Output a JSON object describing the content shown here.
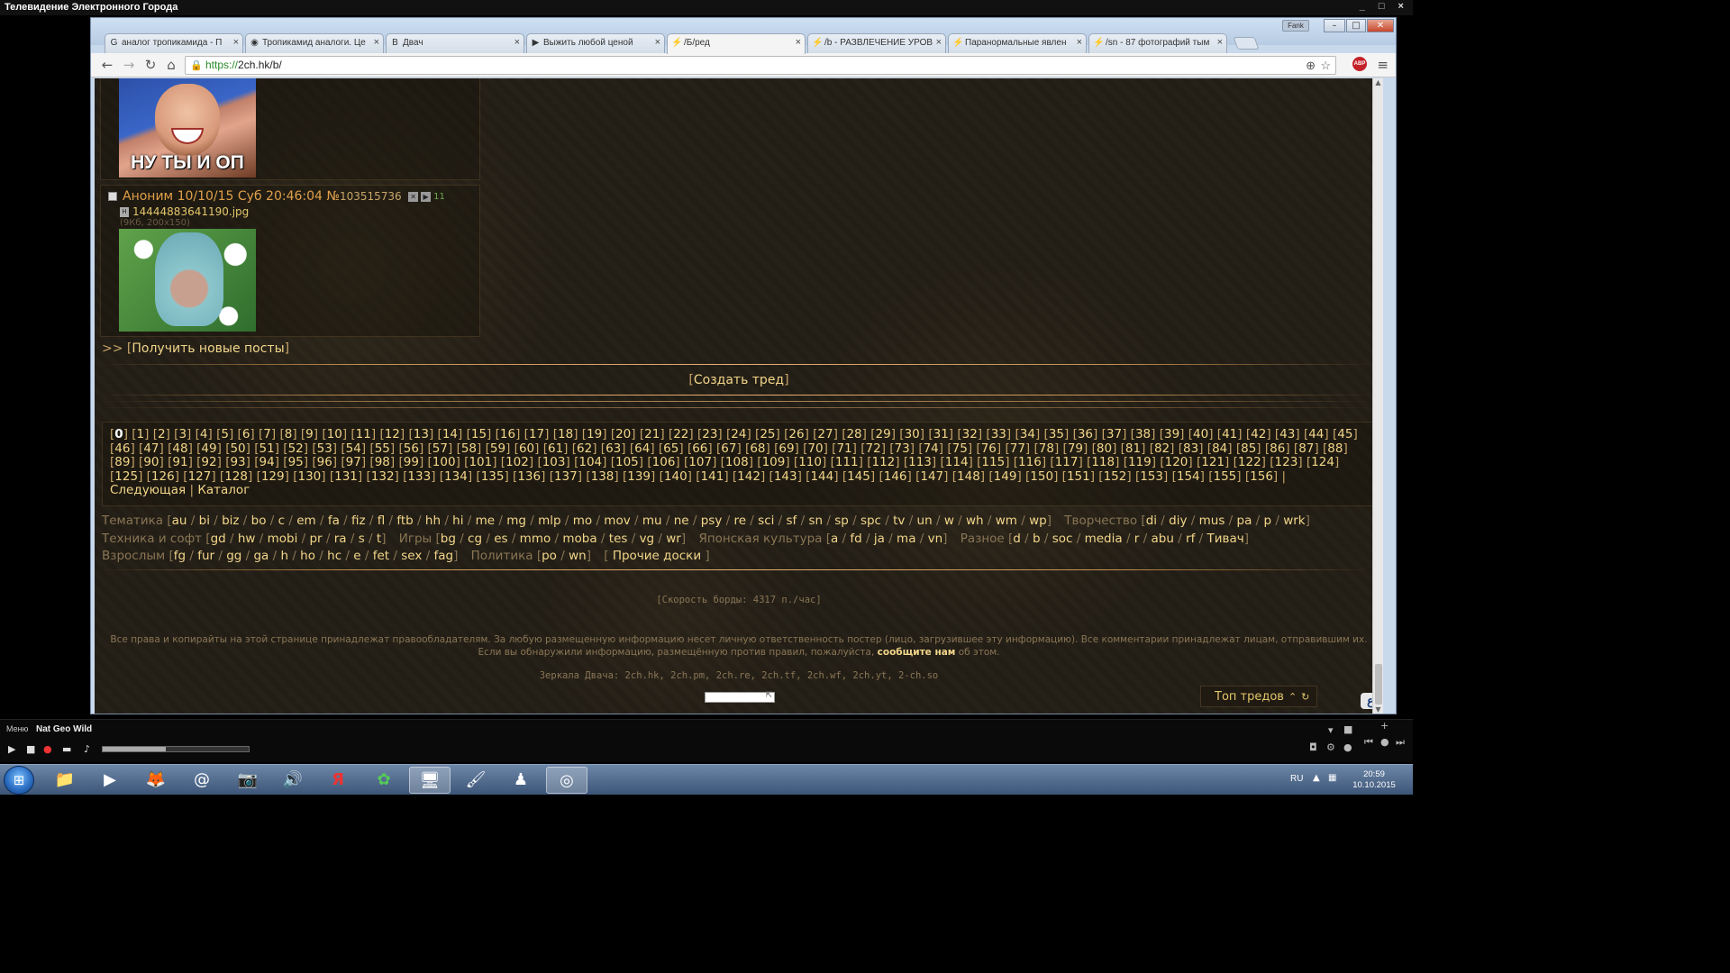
{
  "app": {
    "title": "Телевидение Электронного Города",
    "window_buttons": "_ □ ×"
  },
  "browser": {
    "profile": "Fank",
    "tabs": [
      {
        "label": "аналог тропикамида - П",
        "favicon": "G",
        "active": false
      },
      {
        "label": "Тропикамид аналоги. Це",
        "favicon": "◉",
        "active": false
      },
      {
        "label": "Двач",
        "favicon": "В",
        "active": false
      },
      {
        "label": "Выжить любой ценой",
        "favicon": "▶",
        "active": false
      },
      {
        "label": "/Б/ред",
        "favicon": "⚡",
        "active": true
      },
      {
        "label": "/b - РАЗВЛЕЧЕНИЕ УРОВ",
        "favicon": "⚡",
        "active": false
      },
      {
        "label": "Паранормальные явлен",
        "favicon": "⚡",
        "active": false
      },
      {
        "label": "/sn - 87 фотографий тым",
        "favicon": "⚡",
        "active": false
      }
    ],
    "tab_close": "×",
    "url_scheme": "https://",
    "url_rest": "2ch.hk/b/",
    "abp": "ABP"
  },
  "page": {
    "post1": {
      "caption": "НУ ТЫ И ОП"
    },
    "post2": {
      "author": "Аноним",
      "datetime": "10/10/15 Суб 20:46:04",
      "num_prefix": "№",
      "num": "103515736",
      "replies": "11",
      "filename": "14444883641190.jpg",
      "filemeta": "(9Кб, 200x150)"
    },
    "get_new": {
      "prefix": ">> [",
      "label": "Получить новые посты",
      "suffix": "]"
    },
    "create_thread": "Создать тред",
    "pager": {
      "pages": [
        "0",
        "1",
        "2",
        "3",
        "4",
        "5",
        "6",
        "7",
        "8",
        "9",
        "10",
        "11",
        "12",
        "13",
        "14",
        "15",
        "16",
        "17",
        "18",
        "19",
        "20",
        "21",
        "22",
        "23",
        "24",
        "25",
        "26",
        "27",
        "28",
        "29",
        "30",
        "31",
        "32",
        "33",
        "34",
        "35",
        "36",
        "37",
        "38",
        "39",
        "40",
        "41",
        "42",
        "43",
        "44",
        "45",
        "46",
        "47",
        "48",
        "49",
        "50",
        "51",
        "52",
        "53",
        "54",
        "55",
        "56",
        "57",
        "58",
        "59",
        "60",
        "61",
        "62",
        "63",
        "64",
        "65",
        "66",
        "67",
        "68",
        "69",
        "70",
        "71",
        "72",
        "73",
        "74",
        "75",
        "76",
        "77",
        "78",
        "79",
        "80",
        "81",
        "82",
        "83",
        "84",
        "85",
        "86",
        "87",
        "88",
        "89",
        "90",
        "91",
        "92",
        "93",
        "94",
        "95",
        "96",
        "97",
        "98",
        "99",
        "100",
        "101",
        "102",
        "103",
        "104",
        "105",
        "106",
        "107",
        "108",
        "109",
        "110",
        "111",
        "112",
        "113",
        "114",
        "115",
        "116",
        "117",
        "118",
        "119",
        "120",
        "121",
        "122",
        "123",
        "124",
        "125",
        "126",
        "127",
        "128",
        "129",
        "130",
        "131",
        "132",
        "133",
        "134",
        "135",
        "136",
        "137",
        "138",
        "139",
        "140",
        "141",
        "142",
        "143",
        "144",
        "145",
        "146",
        "147",
        "148",
        "149",
        "150",
        "151",
        "152",
        "153",
        "154",
        "155",
        "156"
      ],
      "current": "0",
      "next": "Следующая",
      "catalog": "Каталог"
    },
    "boards": [
      {
        "group": "Тематика",
        "items": [
          "au",
          "bi",
          "biz",
          "bo",
          "c",
          "em",
          "fa",
          "fiz",
          "fl",
          "ftb",
          "hh",
          "hi",
          "me",
          "mg",
          "mlp",
          "mo",
          "mov",
          "mu",
          "ne",
          "psy",
          "re",
          "sci",
          "sf",
          "sn",
          "sp",
          "spc",
          "tv",
          "un",
          "w",
          "wh",
          "wm",
          "wp"
        ]
      },
      {
        "group": "Творчество",
        "items": [
          "di",
          "diy",
          "mus",
          "pa",
          "p",
          "wrk"
        ]
      },
      {
        "group": "Техника и софт",
        "items": [
          "gd",
          "hw",
          "mobi",
          "pr",
          "ra",
          "s",
          "t"
        ]
      },
      {
        "group": "Игры",
        "items": [
          "bg",
          "cg",
          "es",
          "mmo",
          "moba",
          "tes",
          "vg",
          "wr"
        ]
      },
      {
        "group": "Японская культура",
        "items": [
          "a",
          "fd",
          "ja",
          "ma",
          "vn"
        ]
      },
      {
        "group": "Разное",
        "items": [
          "d",
          "b",
          "soc",
          "media",
          "r",
          "abu",
          "rf",
          "Тивач"
        ]
      },
      {
        "group": "Взрослым",
        "items": [
          "fg",
          "fur",
          "gg",
          "ga",
          "h",
          "ho",
          "hc",
          "e",
          "fet",
          "sex",
          "fag"
        ]
      },
      {
        "group": "Политика",
        "items": [
          "po",
          "wn"
        ]
      }
    ],
    "other_boards": "Прочие доски",
    "speed": "[Скорость борды: 4317 п./час]",
    "copyright_1": "Все права и копирайты на этой странице принадлежат правообладателям. За любую размещенную информацию несет личную ответственность постер (лицо, загрузившее эту информацию). Все комментарии принадлежат лицам, отправившим их.",
    "copyright_2a": "Если вы обнаружили информацию, размещённую против правил, пожалуйста,",
    "copyright_link": "сообщите нам",
    "copyright_2b": "об этом.",
    "mirrors": "Зеркала Двача: 2ch.hk, 2ch.pm, 2ch.re, 2ch.tf, 2ch.wf, 2ch.yt, 2-ch.so",
    "top_threads": "Топ тредов"
  },
  "player": {
    "menu": "Меню",
    "channel": "Nat Geo Wild",
    "progress": 0.43
  },
  "taskbar": {
    "lang": "RU",
    "time": "20:59",
    "date": "10.10.2015"
  }
}
